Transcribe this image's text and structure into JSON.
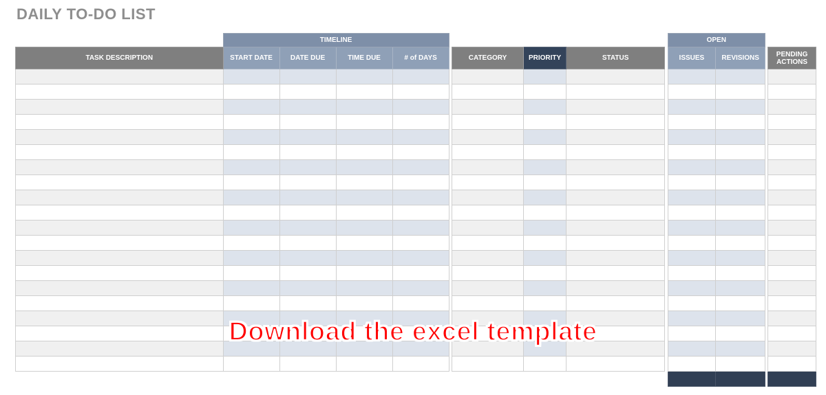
{
  "title": "DAILY TO-DO LIST",
  "groups": {
    "timeline": "TIMELINE",
    "open": "OPEN"
  },
  "columns": {
    "task_description": "TASK DESCRIPTION",
    "start_date": "START DATE",
    "date_due": "DATE DUE",
    "time_due": "TIME DUE",
    "num_days": "# of DAYS",
    "category": "CATEGORY",
    "priority": "PRIORITY",
    "status": "STATUS",
    "issues": "ISSUES",
    "revisions": "REVISIONS",
    "pending_actions_l1": "PENDING",
    "pending_actions_l2": "ACTIONS"
  },
  "overlay_text": "Download the excel template",
  "row_count": 20,
  "colors": {
    "title_gray": "#8e8e8e",
    "header_gray": "#7f7f7f",
    "header_slate": "#7e8fa8",
    "header_slate_light": "#8fa0b7",
    "priority_dark": "#33435a",
    "zebra_gray": "#f0f0f0",
    "zebra_slate": "#dde3ec",
    "footer_dark": "#313f54",
    "overlay_red": "#ff0000"
  }
}
